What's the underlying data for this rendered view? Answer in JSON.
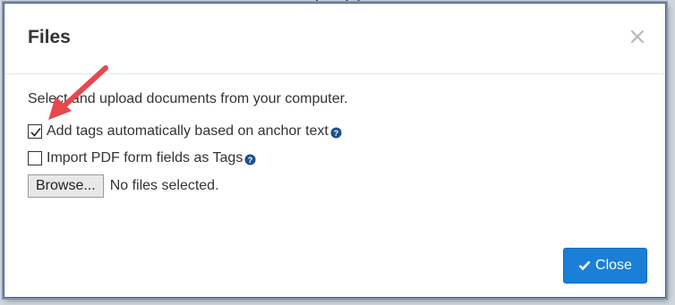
{
  "dialog": {
    "title": "Files",
    "instruction": "Select and upload documents from your computer.",
    "options": [
      {
        "label": "Add tags automatically based on anchor text",
        "checked": true
      },
      {
        "label": "Import PDF form fields as Tags",
        "checked": false
      }
    ],
    "browse_label": "Browse...",
    "file_status": "No files selected.",
    "close_button_label": "Close"
  },
  "colors": {
    "primary_button": "#1a7fd6",
    "help_icon": "#1f4f8f",
    "annotation_arrow": "#e8474c"
  }
}
